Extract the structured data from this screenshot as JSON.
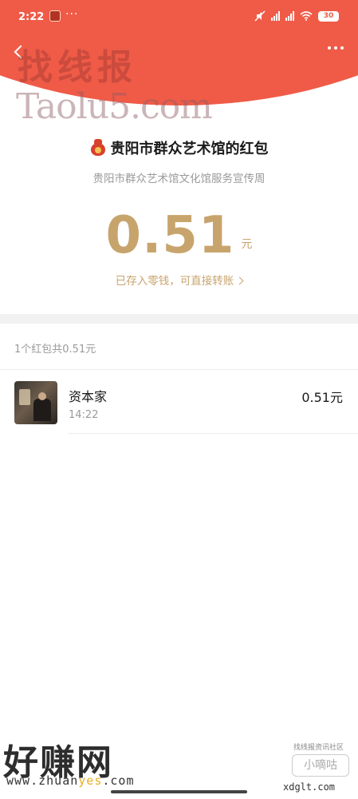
{
  "status_bar": {
    "time": "2:22",
    "dots": "···",
    "battery": "30"
  },
  "watermarks": {
    "top_cn": "找线报",
    "top_en": "Taolu5.com",
    "bottom_cn": "好赚网",
    "bottom_url_a": "www.zhuan",
    "bottom_url_b": "yes",
    "bottom_url_c": ".com",
    "right_small": "找线报资讯社区",
    "right_badge": "小嘀咕",
    "right_url": "xdglt.com"
  },
  "packet": {
    "title": "贵阳市群众艺术馆的红包",
    "subtitle": "贵阳市群众艺术馆文化馆服务宣传周",
    "amount": "0.51",
    "unit": "元",
    "saved_note": "已存入零钱，可直接转账"
  },
  "summary": "1个红包共0.51元",
  "records": [
    {
      "name": "资本家",
      "time": "14:22",
      "amount": "0.51元"
    }
  ],
  "colors": {
    "header_red": "#ef5b47",
    "gold": "#c8a46d"
  }
}
